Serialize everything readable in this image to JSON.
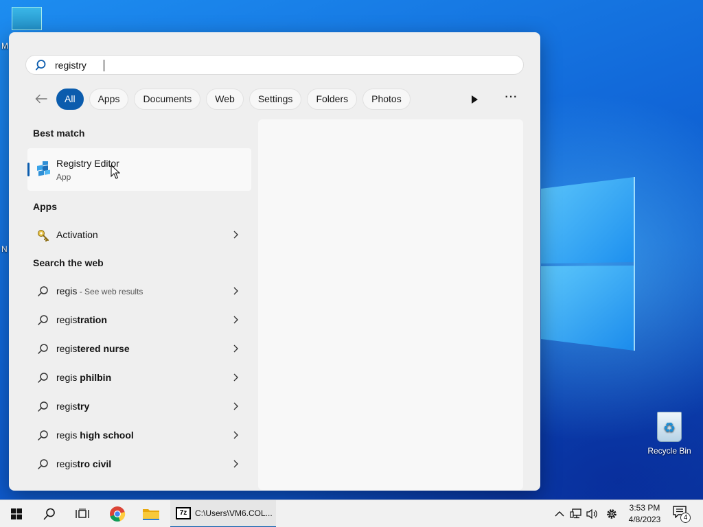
{
  "search": {
    "value": "registry",
    "placeholder": ""
  },
  "filters": {
    "items": [
      "All",
      "Apps",
      "Documents",
      "Web",
      "Settings",
      "Folders",
      "Photos"
    ],
    "active": "All"
  },
  "best_match": {
    "title": "Best match",
    "name": "Registry Editor",
    "type": "App"
  },
  "apps": {
    "title": "Apps",
    "items": [
      {
        "label": "Activation"
      }
    ]
  },
  "web": {
    "title": "Search the web",
    "items": [
      {
        "prefix": "regis",
        "suffix": "",
        "sub": " - See web results"
      },
      {
        "prefix": "regis",
        "suffix": "tration",
        "sub": ""
      },
      {
        "prefix": "regis",
        "suffix": "tered nurse",
        "sub": ""
      },
      {
        "prefix": "regis",
        "suffix": " philbin",
        "sub": ""
      },
      {
        "prefix": "regis",
        "suffix": "try",
        "sub": ""
      },
      {
        "prefix": "regis",
        "suffix": " high school",
        "sub": ""
      },
      {
        "prefix": "regis",
        "suffix": "tro civil",
        "sub": ""
      }
    ]
  },
  "desktop": {
    "recycle_bin_label": "Recycle Bin",
    "edge_letters": [
      "M",
      "N"
    ]
  },
  "taskbar": {
    "window_label": "C:\\Users\\VM6.COL...",
    "window_icon_text": "7z",
    "time": "3:53 PM",
    "date": "4/8/2023",
    "notification_count": "4"
  },
  "colors": {
    "accent": "#0b5cad",
    "panel_bg": "#efefef",
    "desktop_blue": "#1168d8"
  }
}
